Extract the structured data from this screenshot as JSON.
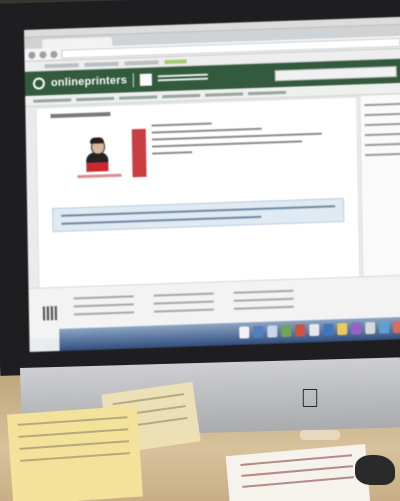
{
  "site": {
    "brand_name": "onlineprinters"
  },
  "colors": {
    "header_green": "#2f5b3a",
    "accent_red": "#d63a3f",
    "notice_blue": "#dfeaf4",
    "sticky_note_yellow": "#f4e19a"
  },
  "icons": {
    "apple_logo": "apple-logo-icon",
    "site_logo": "logo-circle-icon"
  }
}
